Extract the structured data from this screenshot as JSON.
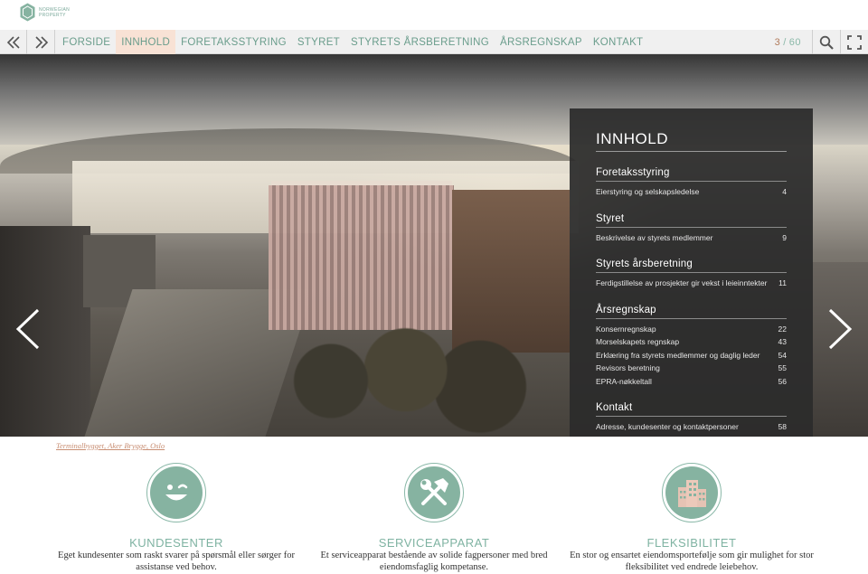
{
  "brand": {
    "logo_text": "NORWEGIAN PROPERTY",
    "accent": "#86b3a1",
    "active_bg": "#f8e2d5"
  },
  "nav": {
    "items": [
      {
        "label": "FORSIDE",
        "active": false
      },
      {
        "label": "INNHOLD",
        "active": true
      },
      {
        "label": "FORETAKSSTYRING",
        "active": false
      },
      {
        "label": "STYRET",
        "active": false
      },
      {
        "label": "STYRETS ÅRSBERETNING",
        "active": false
      },
      {
        "label": "ÅRSREGNSKAP",
        "active": false
      },
      {
        "label": "KONTAKT",
        "active": false
      }
    ],
    "page_current": "3",
    "page_separator": "/",
    "page_total": "60"
  },
  "contents": {
    "title": "INNHOLD",
    "sections": [
      {
        "title": "Foretaksstyring",
        "entries": [
          {
            "label": "Eierstyring og selskapsledelse",
            "page": "4"
          }
        ]
      },
      {
        "title": "Styret",
        "entries": [
          {
            "label": "Beskrivelse av styrets medlemmer",
            "page": "9"
          }
        ]
      },
      {
        "title": "Styrets årsberetning",
        "entries": [
          {
            "label": "Ferdigstillelse av prosjekter gir vekst i leieinntekter",
            "page": "11"
          }
        ]
      },
      {
        "title": "Årsregnskap",
        "entries": [
          {
            "label": "Konsernregnskap",
            "page": "22"
          },
          {
            "label": "Morselskapets regnskap",
            "page": "43"
          },
          {
            "label": "Erklæring fra styrets medlemmer og daglig leder",
            "page": "54"
          },
          {
            "label": "Revisors beretning",
            "page": "55"
          },
          {
            "label": "EPRA-nøkkeltall",
            "page": "56"
          }
        ]
      },
      {
        "title": "Kontakt",
        "entries": [
          {
            "label": "Adresse, kundesenter og kontaktpersoner",
            "page": "58"
          }
        ]
      }
    ]
  },
  "caption": "Terminalbygget, Aker Brygge, Oslo",
  "features": [
    {
      "icon": "smiley-wink-icon",
      "title": "KUNDESENTER",
      "text": "Eget kundesenter som raskt svarer på spørsmål eller sørger for assistanse ved behov."
    },
    {
      "icon": "tools-icon",
      "title": "SERVICEAPPARAT",
      "text": "Et serviceapparat bestående av solide fagpersoner med bred eiendomsfaglig kompetanse."
    },
    {
      "icon": "buildings-icon",
      "title": "FLEKSIBILITET",
      "text": "En stor og ensartet eiendomsportefølje som gir mulighet for stor fleksibilitet ved endrede leiebehov."
    }
  ]
}
